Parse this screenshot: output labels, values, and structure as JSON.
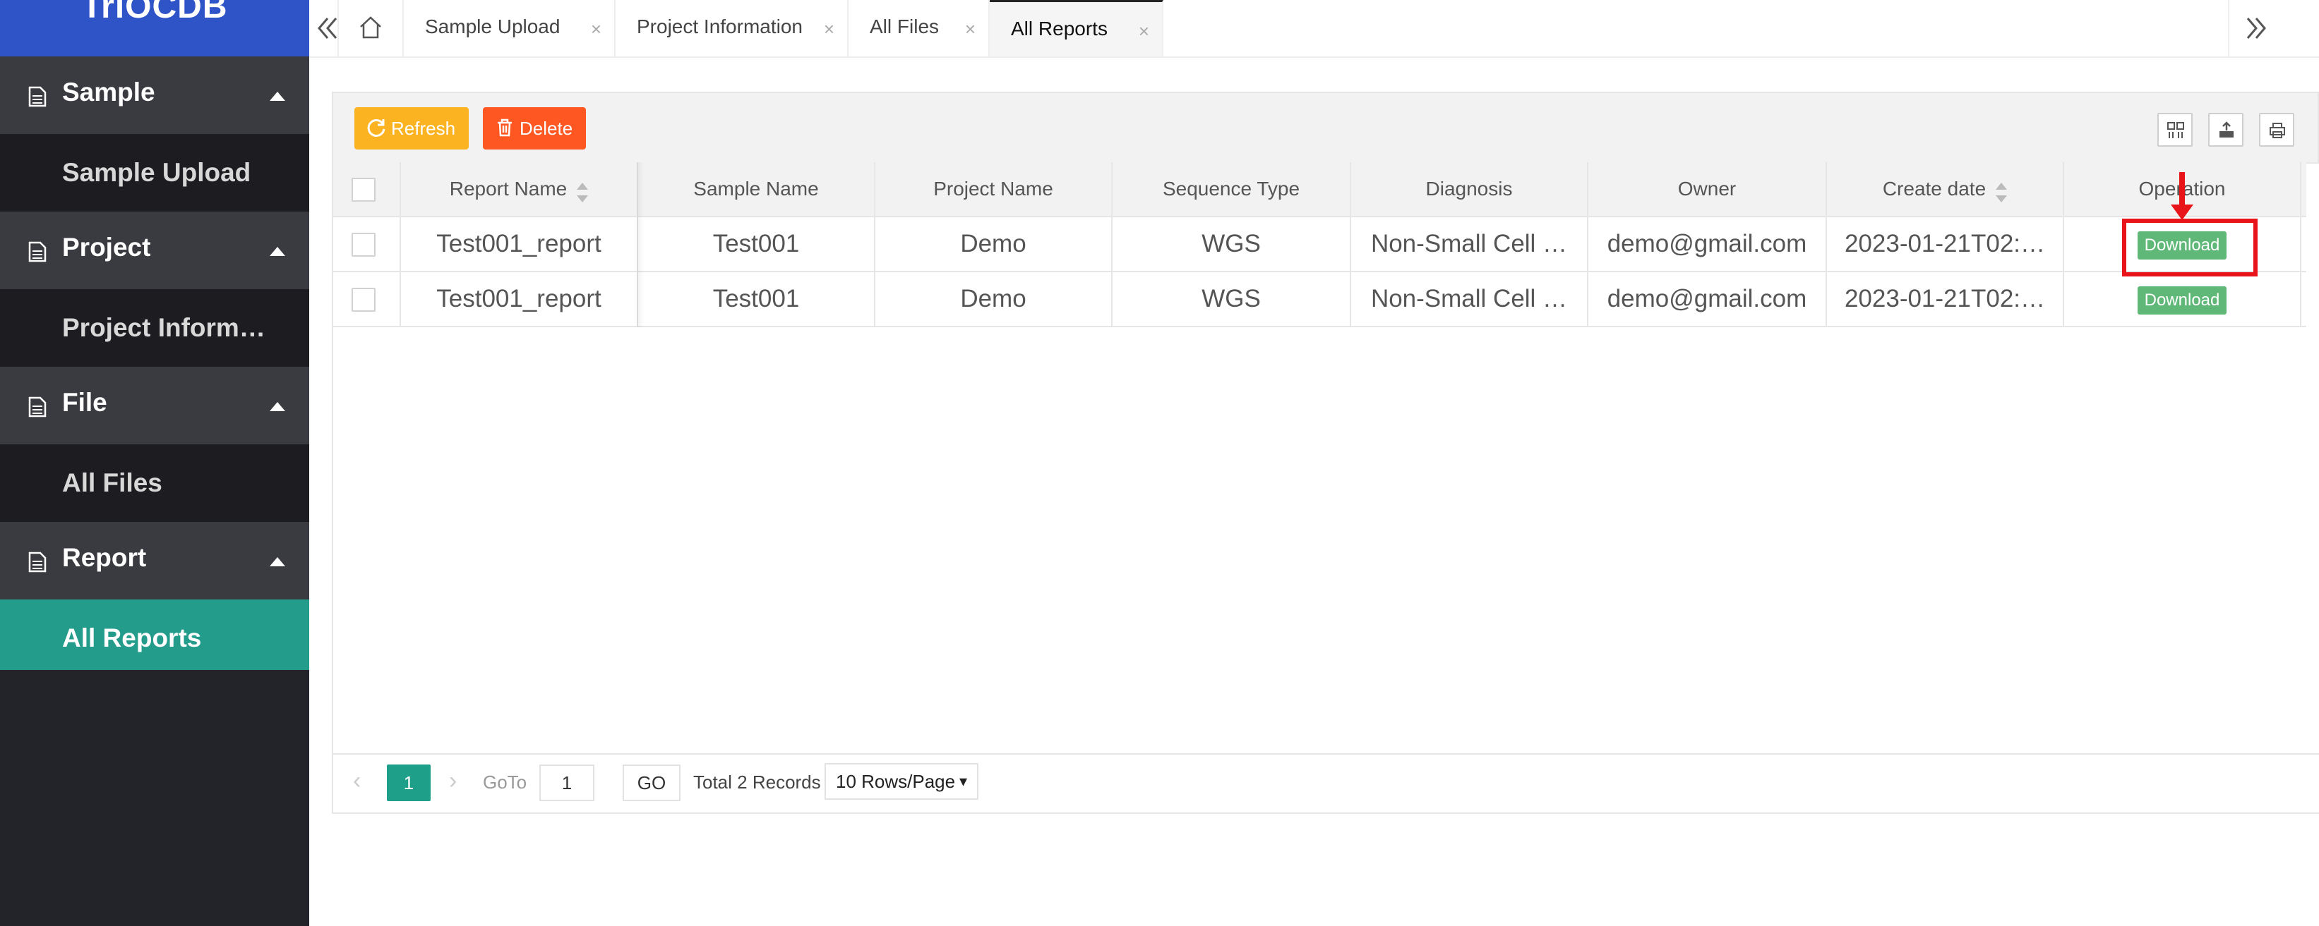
{
  "app": {
    "logo_text": "TriOCDB"
  },
  "sidebar": {
    "groups": [
      {
        "label": "Sample",
        "items": [
          {
            "label": "Sample Upload"
          }
        ]
      },
      {
        "label": "Project",
        "items": [
          {
            "label": "Project Inform…"
          }
        ]
      },
      {
        "label": "File",
        "items": [
          {
            "label": "All Files"
          }
        ]
      },
      {
        "label": "Report",
        "items": [
          {
            "label": "All Reports"
          }
        ]
      }
    ]
  },
  "tabs": [
    {
      "label": "Sample Upload"
    },
    {
      "label": "Project Information"
    },
    {
      "label": "All Files"
    },
    {
      "label": "All Reports"
    }
  ],
  "tab_close_glyph": "×",
  "toolbar": {
    "refresh_label": "Refresh",
    "delete_label": "Delete"
  },
  "table": {
    "columns": [
      "Report Name",
      "Sample Name",
      "Project Name",
      "Sequence Type",
      "Diagnosis",
      "Owner",
      "Create date",
      "Operation"
    ],
    "rows": [
      {
        "report_name": "Test001_report",
        "sample_name": "Test001",
        "project_name": "Demo",
        "sequence_type": "WGS",
        "diagnosis": "Non-Small Cell …",
        "owner": "demo@gmail.com",
        "create_date": "2023-01-21T02:…",
        "action": "Download"
      },
      {
        "report_name": "Test001_report",
        "sample_name": "Test001",
        "project_name": "Demo",
        "sequence_type": "WGS",
        "diagnosis": "Non-Small Cell …",
        "owner": "demo@gmail.com",
        "create_date": "2023-01-21T02:…",
        "action": "Download"
      }
    ]
  },
  "pager": {
    "current_page": "1",
    "goto_label": "GoTo",
    "goto_value": "1",
    "go_label": "GO",
    "total_text": "Total 2 Records",
    "rows_per_page": "10 Rows/Page"
  },
  "colors": {
    "sidebar_active": "#239c8b",
    "refresh_button": "#fbb322",
    "delete_button": "#ff5722",
    "download_button": "#5fb878",
    "annotation": "#e8141a"
  }
}
